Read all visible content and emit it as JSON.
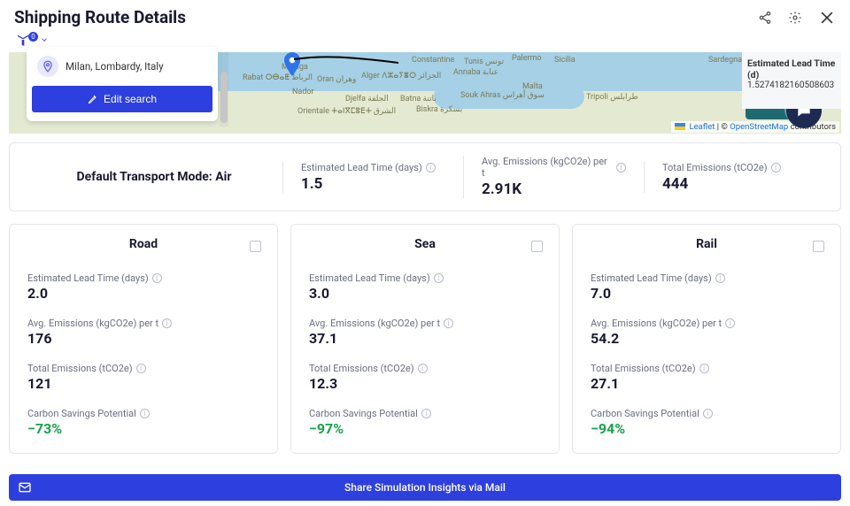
{
  "header": {
    "title": "Shipping Route Details",
    "filter_badge": "0"
  },
  "search": {
    "location": "Milan, Lombardy, Italy",
    "edit_label": "Edit search"
  },
  "side": {
    "label": "Estimated Lead Time (d)",
    "value": "1.5274182160508603"
  },
  "map": {
    "labels": {
      "malaga": "Málaga",
      "oran": "Oran وهران",
      "alger": "Alger ⴷⵣⴰⵢⴻⵔ الجزائر",
      "constantine": "Constantine",
      "tunis": "Tunis تونس",
      "malta": "Malta",
      "palermo": "Palermo",
      "rabat": "Rabat ⵔⴱⴰⵟ الرباط",
      "orientale": "Orientale ⵜⴰⵏⴳⵎⵓⴹⵜ الشرق",
      "sicilia": "Sicilia",
      "annaba": "Annaba عنابة",
      "nador": "Nador",
      "djelfa": "Djelfa الجلفة",
      "batna": "Batna باتنة",
      "biskra": "Biskra بسكرة",
      "souk": "Souk Ahras سوق أهراس",
      "sardegna": "Sardegna",
      "tripoli": "Tripoli طرابلس"
    },
    "attrib": {
      "leaflet": "Leaflet",
      "osm": "OpenStreetMap",
      "contrib": "contributors"
    }
  },
  "defaultMode": {
    "title": "Default Transport Mode: Air",
    "leadTimeLabel": "Estimated Lead Time (days)",
    "leadTimeValue": "1.5",
    "avgEmLabel": "Avg. Emissions (kgCO2e) per t",
    "avgEmValue": "2.91K",
    "totEmLabel": "Total Emissions (tCO2e)",
    "totEmValue": "444"
  },
  "modes": [
    {
      "title": "Road",
      "leadTimeLabel": "Estimated Lead Time (days)",
      "leadTimeValue": "2.0",
      "avgEmLabel": "Avg. Emissions (kgCO2e) per t",
      "avgEmValue": "176",
      "totEmLabel": "Total Emissions (tCO2e)",
      "totEmValue": "121",
      "savingsLabel": "Carbon Savings Potential",
      "savingsValue": "−73%"
    },
    {
      "title": "Sea",
      "leadTimeLabel": "Estimated Lead Time (days)",
      "leadTimeValue": "3.0",
      "avgEmLabel": "Avg. Emissions (kgCO2e) per t",
      "avgEmValue": "37.1",
      "totEmLabel": "Total Emissions (tCO2e)",
      "totEmValue": "12.3",
      "savingsLabel": "Carbon Savings Potential",
      "savingsValue": "−97%"
    },
    {
      "title": "Rail",
      "leadTimeLabel": "Estimated Lead Time (days)",
      "leadTimeValue": "7.0",
      "avgEmLabel": "Avg. Emissions (kgCO2e) per t",
      "avgEmValue": "54.2",
      "totEmLabel": "Total Emissions (tCO2e)",
      "totEmValue": "27.1",
      "savingsLabel": "Carbon Savings Potential",
      "savingsValue": "−94%"
    }
  ],
  "shareBar": {
    "label": "Share Simulation Insights via Mail"
  }
}
